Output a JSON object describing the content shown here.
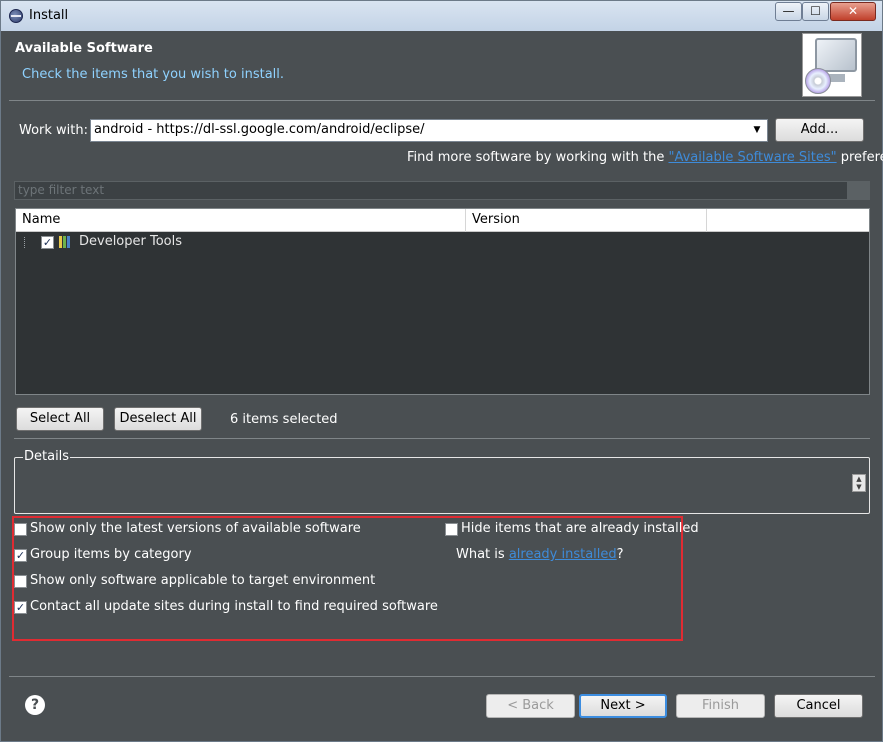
{
  "window": {
    "title": "Install",
    "app_icon": "eclipse-icon",
    "controls": {
      "minimize": "—",
      "maximize": "☐",
      "close": "✕"
    }
  },
  "banner": {
    "title": "Available Software",
    "subtitle": "Check the items that you wish to install.",
    "graphic": "install-monitor-cd-icon"
  },
  "work_with": {
    "label": "Work with:",
    "value": "android - https://dl-ssl.google.com/android/eclipse/",
    "add_label": "Add..."
  },
  "find_more": {
    "prefix": "Find more software by working with the ",
    "link": "\"Available Software Sites\"",
    "suffix": " preferences."
  },
  "filter": {
    "placeholder": "type filter text"
  },
  "table": {
    "columns": [
      "Name",
      "Version"
    ],
    "rows": [
      {
        "name": "Developer Tools",
        "version": "",
        "checked": true,
        "icon": "package-icon"
      }
    ]
  },
  "selection": {
    "select_all_label": "Select All",
    "deselect_all_label": "Deselect All",
    "count_text": "6 items selected"
  },
  "details": {
    "legend": "Details"
  },
  "options": {
    "show_latest": {
      "label": "Show only the latest versions of available software",
      "checked": false
    },
    "hide_installed": {
      "label": "Hide items that are already installed",
      "checked": false
    },
    "group_by_category": {
      "label": "Group items by category",
      "checked": true
    },
    "already_installed": {
      "prefix": "What is ",
      "link": "already installed",
      "suffix": "?"
    },
    "target_env": {
      "label": "Show only software applicable to target environment",
      "checked": false
    },
    "contact_sites": {
      "label": "Contact all update sites during install to find required software",
      "checked": true
    }
  },
  "footer": {
    "help": "?",
    "back_label": "< Back",
    "next_label": "Next >",
    "finish_label": "Finish",
    "cancel_label": "Cancel"
  },
  "colors": {
    "window_bg": "#4a4f52",
    "tree_bg": "#2f3335",
    "link": "#3e8bd9",
    "highlight_box": "#e02b32",
    "subtitle": "#8fd2ff"
  }
}
